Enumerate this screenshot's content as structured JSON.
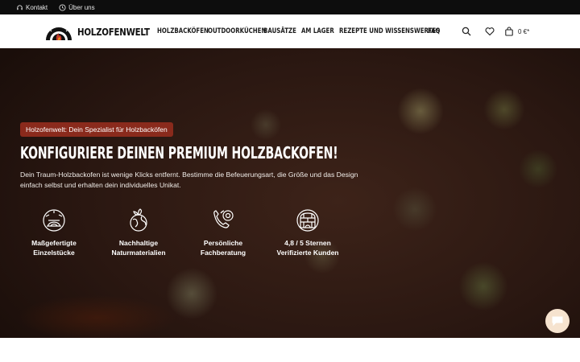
{
  "topbar": {
    "contact_label": "Kontakt",
    "about_label": "Über uns"
  },
  "brand": {
    "name": "HOLZOFENWELT"
  },
  "nav": {
    "items": [
      {
        "label": "HOLZBACKÖFEN"
      },
      {
        "label": "OUTDOORKÜCHEN"
      },
      {
        "label": "BAUSÄTZE"
      },
      {
        "label": "AM LAGER"
      },
      {
        "label": "REZEPTE UND WISSENSWERTES"
      },
      {
        "label": "FAQ"
      }
    ]
  },
  "header_actions": {
    "search_icon": "search-icon",
    "wishlist_icon": "heart-icon",
    "cart_icon": "shopping-bag-icon",
    "cart_total": "0 €*"
  },
  "hero": {
    "badge": "Holzofenwelt: Dein Spezialist für Holzbacköfen",
    "title": "KONFIGURIERE DEINEN PREMIUM HOLZBACKOFEN!",
    "text": "Dein Traum-Holzbackofen ist wenige Klicks entfernt. Bestimme die Befeuerungsart, die Größe und das Design einfach selbst und erhalten dein individuelles Unikat.",
    "features": [
      {
        "icon": "handcrafted-oven-icon",
        "label": "Maßgefertigte\nEinzelstücke"
      },
      {
        "icon": "sustainable-globe-icon",
        "label": "Nachhaltige\nNaturmaterialien"
      },
      {
        "icon": "phone-support-icon",
        "label": "Persönliche\nFachberatung"
      },
      {
        "icon": "brick-oven-icon",
        "label": "4,8 / 5 Sternen\nVerifizierte Kunden"
      }
    ]
  },
  "chat": {
    "icon": "chat-bubble-icon"
  },
  "colors": {
    "topbar_bg": "#0d0d0d",
    "badge_bg": "#8a2a1c",
    "logo_red": "#c0392b",
    "chat_bg": "#f6e3cf"
  }
}
